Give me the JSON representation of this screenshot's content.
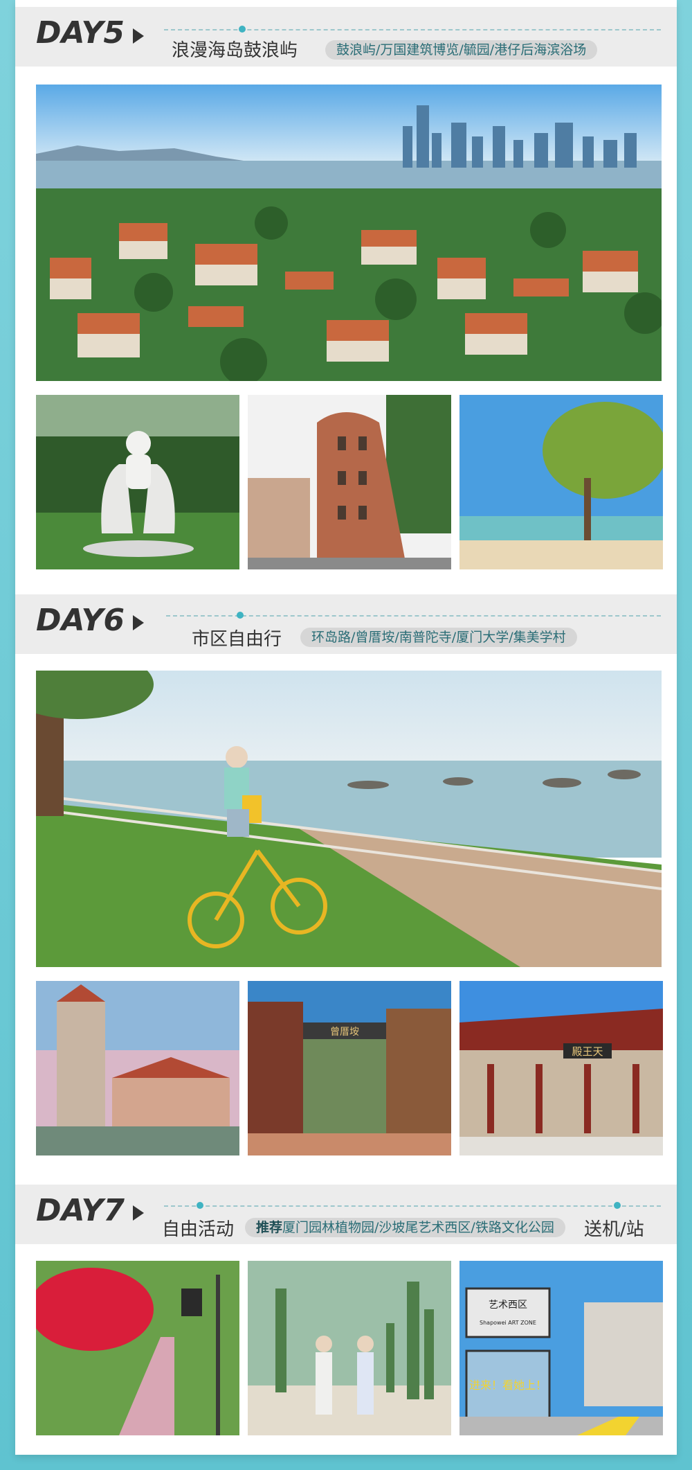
{
  "days": [
    {
      "title": "DAY5",
      "subtitle": "浪漫海岛鼓浪屿",
      "spots": "鼓浪屿/万国建筑博览/毓园/港仔后海滨浴场"
    },
    {
      "title": "DAY6",
      "subtitle": "市区自由行",
      "spots": "环岛路/曾厝垵/南普陀寺/厦门大学/集美学村"
    },
    {
      "title": "DAY7",
      "subtitle": "自由活动",
      "recommend": "推荐",
      "spots": "厦门园林植物园/沙坡尾艺术西区/铁路文化公园",
      "tail": "送机/站"
    }
  ],
  "photos": {
    "day6_plaque": "殿王天",
    "day6_sign": "曾厝垵",
    "day7_art_zone": "艺术西区",
    "day7_art_zone_en": "Shapowei ART ZONE",
    "day7_slogan": "进来！看她上！"
  }
}
